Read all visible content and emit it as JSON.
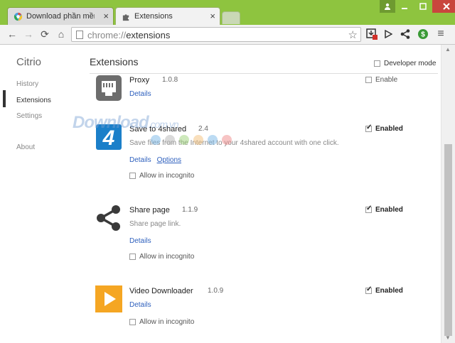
{
  "tabs": [
    {
      "title": "Download phần mềm miễ",
      "close": "×"
    },
    {
      "title": "Extensions",
      "close": "×"
    }
  ],
  "toolbar": {
    "url_scheme": "chrome://",
    "url_path": "extensions",
    "back": "←",
    "forward": "→",
    "reload": "⟳",
    "home": "⌂",
    "star": "☆",
    "menu": "≡"
  },
  "sidebar": {
    "brand": "Citrio",
    "items": [
      {
        "label": "History"
      },
      {
        "label": "Extensions"
      },
      {
        "label": "Settings"
      },
      {
        "label": "About"
      }
    ]
  },
  "main": {
    "title": "Extensions",
    "developer_mode": "Developer mode"
  },
  "extensions": [
    {
      "name": "Proxy",
      "version": "1.0.8",
      "description": "",
      "details": "Details",
      "options": "",
      "incognito": "",
      "state": "Enable",
      "enabled": false
    },
    {
      "name": "Save to 4shared",
      "version": "2.4",
      "description": "Save files from the Internet to your 4shared account with one click.",
      "details": "Details",
      "options": "Options",
      "incognito": "Allow in incognito",
      "state": "Enabled",
      "enabled": true
    },
    {
      "name": "Share page",
      "version": "1.1.9",
      "description": "Share page link.",
      "details": "Details",
      "options": "",
      "incognito": "Allow in incognito",
      "state": "Enabled",
      "enabled": true
    },
    {
      "name": "Video Downloader",
      "version": "1.0.9",
      "description": "",
      "details": "Details",
      "options": "",
      "incognito": "Allow in incognito",
      "state": "Enabled",
      "enabled": true
    }
  ],
  "watermark": {
    "main": "Download",
    "sub": ".com.vn"
  },
  "colors": {
    "frame": "#8ec43f",
    "link": "#2d5fbd",
    "video_icon": "#f5a623",
    "fourshared_icon": "#1b7fc9",
    "close_button": "#c9463d"
  }
}
